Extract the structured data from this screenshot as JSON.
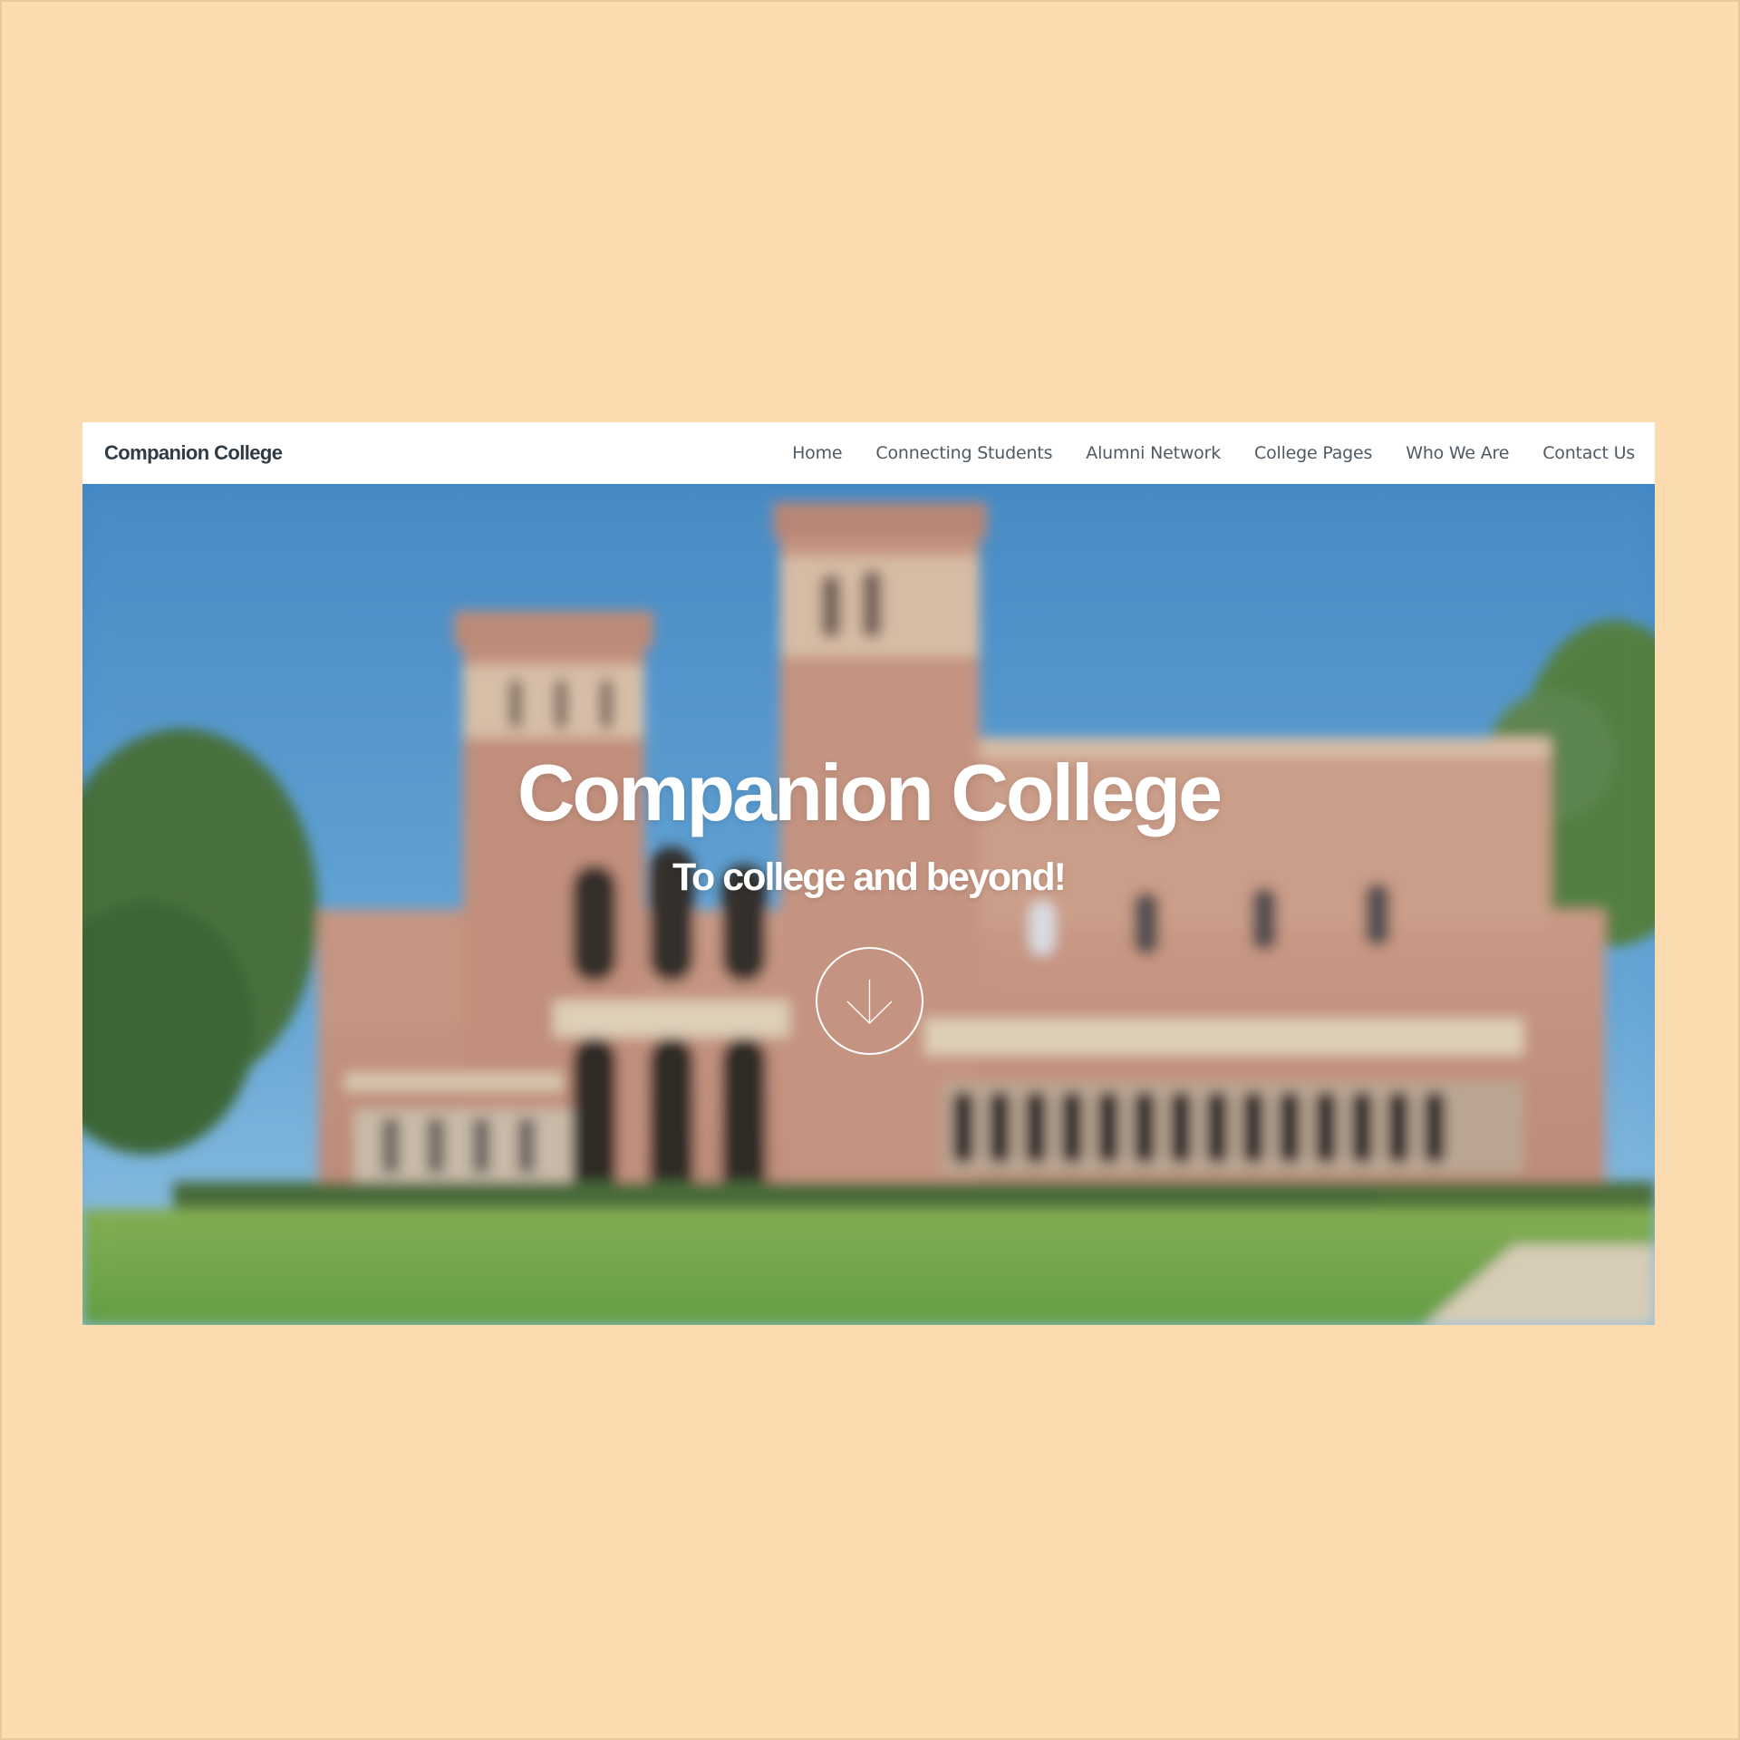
{
  "navbar": {
    "brand": "Companion College",
    "links": [
      {
        "label": "Home"
      },
      {
        "label": "Connecting Students"
      },
      {
        "label": "Alumni Network"
      },
      {
        "label": "College Pages"
      },
      {
        "label": "Who We Are"
      },
      {
        "label": "Contact Us"
      }
    ]
  },
  "hero": {
    "title": "Companion College",
    "subtitle": "To college and beyond!",
    "scroll_icon": "arrow-down-icon"
  },
  "colors": {
    "page_background": "#fddbb0",
    "navbar_background": "#ffffff",
    "brand_text": "#2f3b44",
    "nav_text": "#4e5a63",
    "hero_text": "#ffffff"
  }
}
